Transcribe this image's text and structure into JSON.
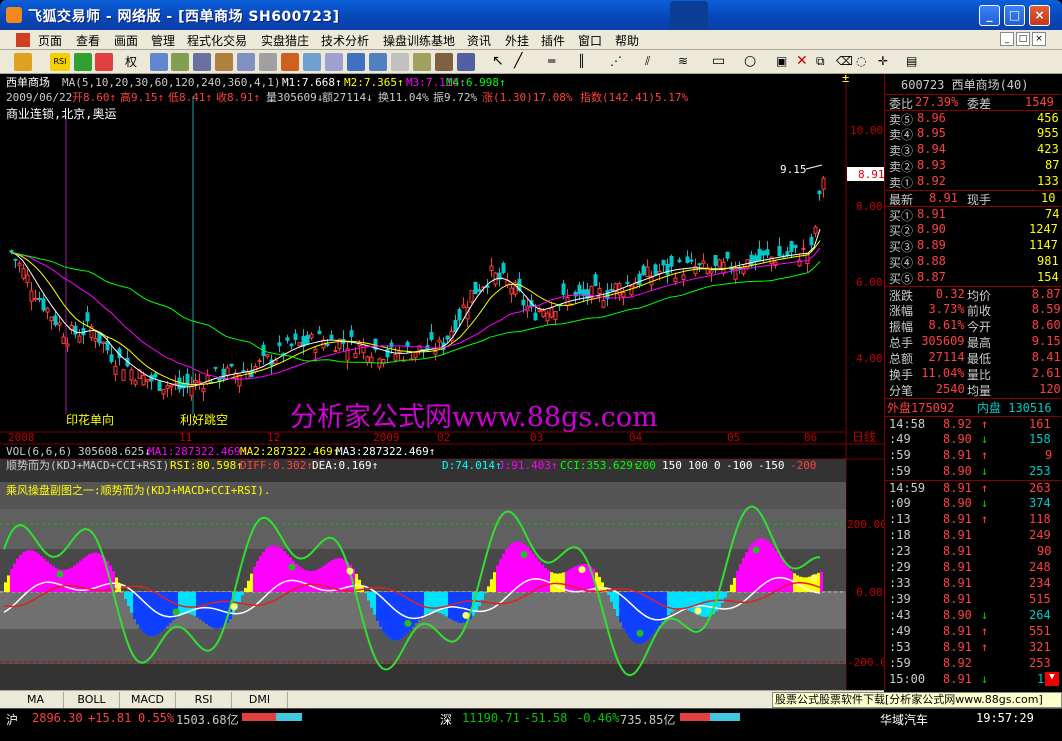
{
  "window": {
    "title": "飞狐交易师 - 网络版 - [西单商场 SH600723]",
    "min": "_",
    "max": "□",
    "close": "×"
  },
  "menu": [
    "页面",
    "查看",
    "画面",
    "管理",
    "程式化交易",
    "实盘猎庄",
    "技术分析",
    "操盘训练基地",
    "资讯",
    "外挂",
    "插件",
    "窗口",
    "帮助"
  ],
  "mdi_buttons": [
    "_",
    "□",
    "×"
  ],
  "toolbar": {
    "quan_label": "权",
    "rsi_label": "RSI"
  },
  "main_chart": {
    "stock_header": "西单商场",
    "ma_params": "MA(5,10,20,30,60,120,240,360,4,1)",
    "m1": "M1:7.668↑",
    "m2": "M2:7.365↑",
    "m3": "M3:7.116↑",
    "m4": "M4:6.998↑",
    "date": "2009/06/22",
    "open": "开8.60↑",
    "high": "高9.15↑",
    "low": "低8.41↑",
    "close": "收8.91↑",
    "volume": "量305609↓",
    "amount": "额27114↓",
    "turnover": "换11.04%",
    "amplitude": "振9.72%",
    "change": "涨(1.30)17.08%",
    "index_change": "指数(142.41)5.17%",
    "concept": "商业连锁,北京,奥运",
    "ann1": "印花单向",
    "ann2": "利好跳空",
    "peak_label": "9.15",
    "current_price_tag": "8.91",
    "price_axis": [
      "10.00",
      "8.00",
      "6.00",
      "4.00"
    ],
    "time_axis": [
      "2008",
      "11",
      "12",
      "2009",
      "02",
      "03",
      "04",
      "05",
      "06"
    ],
    "day_label": "日线"
  },
  "volume_panel": {
    "label": "VOL(6,6,6)",
    "vol": "305608.625↓",
    "ma1": "MA1:287322.469↑",
    "ma2": "MA2:287322.469↑",
    "ma3": "MA3:287322.469↑"
  },
  "indicator": {
    "name": "顺势而为(KDJ+MACD+CCI+RSI)",
    "rsi": "RSI:80.598↑",
    "diff": "DIFF:0.302↑",
    "dea": "DEA:0.169↑",
    "d": "D:74.014↑",
    "j": "J:91.403↑",
    "cci": "CCI:353.629↑",
    "levels": [
      "200",
      "150",
      "100",
      "0",
      "-100",
      "-150",
      "-200"
    ],
    "desc": "乘风操盘副图之一:顺势而为(KDJ+MACD+CCI+RSI).",
    "axis": [
      "200.00",
      "0.00",
      "-200.00"
    ]
  },
  "watermark": "分析家公式网www.88gs.com",
  "bottom_tabs": [
    "MA",
    "BOLL",
    "MACD",
    "RSI",
    "DMI"
  ],
  "ad_text": "股票公式股票软件下载[分析家公式网www.88gs.com]",
  "quote_panel": {
    "code_name": "600723 西单商场(40)",
    "weibi_label": "委比",
    "weibi_val": "27.39%",
    "weicha_label": "委差",
    "weicha_val": "1549",
    "asks": [
      {
        "label": "卖⑤",
        "price": "8.96",
        "vol": "456"
      },
      {
        "label": "卖④",
        "price": "8.95",
        "vol": "955"
      },
      {
        "label": "卖③",
        "price": "8.94",
        "vol": "423"
      },
      {
        "label": "卖②",
        "price": "8.93",
        "vol": "87"
      },
      {
        "label": "卖①",
        "price": "8.92",
        "vol": "133"
      }
    ],
    "last_label": "最新",
    "last_val": "8.91",
    "now_label": "现手",
    "now_val": "10",
    "bids": [
      {
        "label": "买①",
        "price": "8.91",
        "vol": "74"
      },
      {
        "label": "买②",
        "price": "8.90",
        "vol": "1247"
      },
      {
        "label": "买③",
        "price": "8.89",
        "vol": "1147"
      },
      {
        "label": "买④",
        "price": "8.88",
        "vol": "981"
      },
      {
        "label": "买⑤",
        "price": "8.87",
        "vol": "154"
      }
    ],
    "stats": [
      {
        "l1": "涨跌",
        "v1": "0.32",
        "l2": "均价",
        "v2": "8.87"
      },
      {
        "l1": "涨幅",
        "v1": "3.73%",
        "l2": "前收",
        "v2": "8.59"
      },
      {
        "l1": "振幅",
        "v1": "8.61%",
        "l2": "今开",
        "v2": "8.60"
      },
      {
        "l1": "总手",
        "v1": "305609",
        "l2": "最高",
        "v2": "9.15"
      },
      {
        "l1": "总额",
        "v1": "27114",
        "l2": "最低",
        "v2": "8.41"
      },
      {
        "l1": "换手",
        "v1": "11.04%",
        "l2": "量比",
        "v2": "2.61"
      },
      {
        "l1": "分笔",
        "v1": "2540",
        "l2": "均量",
        "v2": "120"
      }
    ],
    "outer": "外盘175092",
    "inner": "内盘 130516",
    "ticks": [
      {
        "t": "14:58",
        "p": "8.92",
        "a": "↑",
        "v": "161"
      },
      {
        "t": ":49",
        "p": "8.90",
        "a": "↓",
        "v": "158"
      },
      {
        "t": ":59",
        "p": "8.91",
        "a": "↑",
        "v": "9"
      },
      {
        "t": ":59",
        "p": "8.90",
        "a": "↓",
        "v": "253"
      },
      {
        "t": "14:59",
        "p": "8.91",
        "a": "↑",
        "v": "263"
      },
      {
        "t": ":09",
        "p": "8.90",
        "a": "↓",
        "v": "374"
      },
      {
        "t": ":13",
        "p": "8.91",
        "a": "↑",
        "v": "118"
      },
      {
        "t": ":18",
        "p": "8.91",
        "a": "",
        "v": "249"
      },
      {
        "t": ":23",
        "p": "8.91",
        "a": "",
        "v": "90"
      },
      {
        "t": ":29",
        "p": "8.91",
        "a": "",
        "v": "248"
      },
      {
        "t": ":33",
        "p": "8.91",
        "a": "",
        "v": "234"
      },
      {
        "t": ":39",
        "p": "8.91",
        "a": "",
        "v": "515"
      },
      {
        "t": ":43",
        "p": "8.90",
        "a": "↓",
        "v": "264"
      },
      {
        "t": ":49",
        "p": "8.91",
        "a": "↑",
        "v": "551"
      },
      {
        "t": ":53",
        "p": "8.91",
        "a": "↑",
        "v": "321"
      },
      {
        "t": ":59",
        "p": "8.92",
        "a": "",
        "v": "253"
      },
      {
        "t": "15:00",
        "p": "8.91",
        "a": "↓",
        "v": "10"
      }
    ],
    "stock_footer": "华域汽车"
  },
  "status": {
    "sh_label": "沪",
    "sh_idx": "2896.30",
    "sh_chg": "+15.81",
    "sh_pct": "0.55%",
    "sh_amt": "1503.68亿",
    "sz_label": "深",
    "sz_idx": "11190.71",
    "sz_chg": "-51.58",
    "sz_pct": "-0.46%",
    "sz_amt": "735.85亿",
    "time": "19:57:29"
  },
  "colors": {
    "up": "#ff3c3c",
    "down": "#00c8c8",
    "yellow": "#ffff00",
    "magenta": "#ff00ff",
    "axis_red": "#c00000"
  }
}
